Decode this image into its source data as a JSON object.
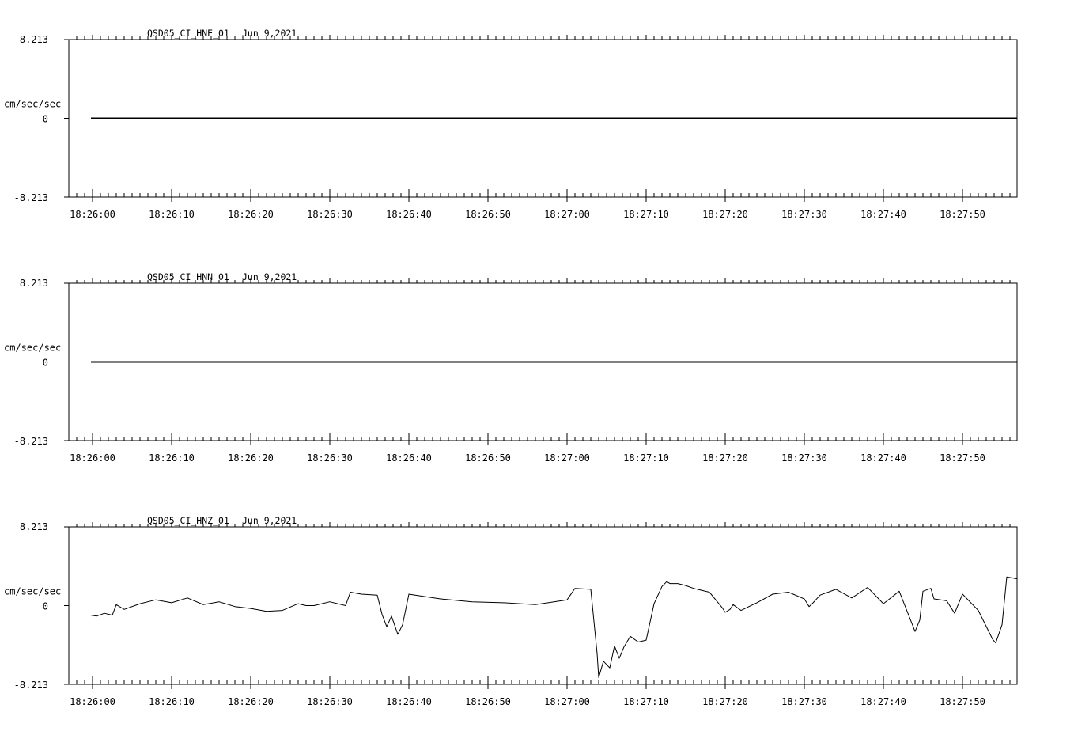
{
  "chart_data": [
    {
      "type": "line",
      "title": "QSD05_CI_HNE_01",
      "date": "Jun 9,2021",
      "ylabel": "cm/sec/sec",
      "ylim": [
        -8.213,
        8.213
      ],
      "y_tick_labels": [
        "8.213",
        "0",
        "-8.213"
      ],
      "x_tick_labels": [
        "18:26:00",
        "18:26:10",
        "18:26:20",
        "18:26:30",
        "18:26:40",
        "18:26:50",
        "18:27:00",
        "18:27:10",
        "18:27:20",
        "18:27:30",
        "18:27:40",
        "18:27:50"
      ],
      "series": [
        {
          "x": [
            -0.2,
            116.9
          ],
          "y": [
            0,
            0
          ]
        }
      ]
    },
    {
      "type": "line",
      "title": "QSD05_CI_HNN_01",
      "date": "Jun 9,2021",
      "ylabel": "cm/sec/sec",
      "ylim": [
        -8.213,
        8.213
      ],
      "y_tick_labels": [
        "8.213",
        "0",
        "-8.213"
      ],
      "x_tick_labels": [
        "18:26:00",
        "18:26:10",
        "18:26:20",
        "18:26:30",
        "18:26:40",
        "18:26:50",
        "18:27:00",
        "18:27:10",
        "18:27:20",
        "18:27:30",
        "18:27:40",
        "18:27:50"
      ],
      "series": [
        {
          "x": [
            -0.2,
            116.9
          ],
          "y": [
            0,
            0
          ]
        }
      ]
    },
    {
      "type": "line",
      "title": "QSD05_CI_HNZ_01",
      "date": "Jun 9,2021",
      "ylabel": "cm/sec/sec",
      "ylim": [
        -8.213,
        8.213
      ],
      "y_tick_labels": [
        "8.213",
        "0",
        "-8.213"
      ],
      "x_tick_labels": [
        "18:26:00",
        "18:26:10",
        "18:26:20",
        "18:26:30",
        "18:26:40",
        "18:26:50",
        "18:27:00",
        "18:27:10",
        "18:27:20",
        "18:27:30",
        "18:27:40",
        "18:27:50"
      ],
      "series": [
        {
          "x": [
            -0.2,
            0.5,
            1.5,
            2.5,
            3.0,
            4.0,
            6.0,
            8.0,
            10.0,
            12.0,
            14.0,
            16.0,
            18.0,
            20.0,
            22.0,
            24.0,
            26.0,
            27.0,
            28.0,
            30.0,
            32.0,
            32.6,
            34.0,
            36.0,
            36.6,
            37.2,
            37.8,
            38.6,
            39.2,
            40.0,
            40.8,
            44.0,
            48.0,
            52.0,
            56.0,
            60.0,
            61.0,
            63.0,
            63.8,
            64.0,
            64.6,
            65.4,
            66.0,
            66.6,
            67.2,
            68.0,
            69.0,
            70.0,
            71.0,
            72.0,
            72.6,
            73.0,
            74.0,
            75.0,
            76.0,
            78.0,
            79.6,
            80.0,
            80.6,
            81.0,
            82.0,
            84.0,
            86.0,
            88.0,
            90.0,
            90.6,
            91.0,
            92.0,
            94.0,
            96.0,
            98.0,
            100.0,
            102.0,
            104.0,
            104.6,
            105.0,
            106.0,
            106.4,
            108.0,
            109.0,
            110.0,
            112.0,
            113.8,
            114.2,
            115.0,
            115.6,
            116.9
          ],
          "y": [
            -1.0,
            -1.1,
            -0.8,
            -1.0,
            0.1,
            -0.4,
            0.2,
            0.6,
            0.3,
            0.8,
            0.1,
            0.4,
            -0.1,
            -0.3,
            -0.6,
            -0.5,
            0.2,
            0.0,
            0.0,
            0.4,
            0.0,
            1.4,
            1.2,
            1.1,
            -0.9,
            -2.2,
            -1.1,
            -3.0,
            -2.0,
            1.2,
            1.1,
            0.7,
            0.4,
            0.3,
            0.1,
            0.6,
            1.8,
            1.7,
            -5.0,
            -7.5,
            -5.8,
            -6.5,
            -4.2,
            -5.5,
            -4.3,
            -3.2,
            -3.8,
            -3.6,
            0.2,
            2.0,
            2.5,
            2.3,
            2.3,
            2.1,
            1.8,
            1.4,
            -0.2,
            -0.7,
            -0.4,
            0.1,
            -0.5,
            0.3,
            1.2,
            1.4,
            0.7,
            -0.1,
            0.2,
            1.1,
            1.7,
            0.8,
            1.9,
            0.2,
            1.5,
            -2.7,
            -1.5,
            1.5,
            1.8,
            0.7,
            0.5,
            -0.8,
            1.2,
            -0.5,
            -3.5,
            -3.9,
            -2.0,
            3.0,
            2.8
          ]
        }
      ]
    }
  ]
}
